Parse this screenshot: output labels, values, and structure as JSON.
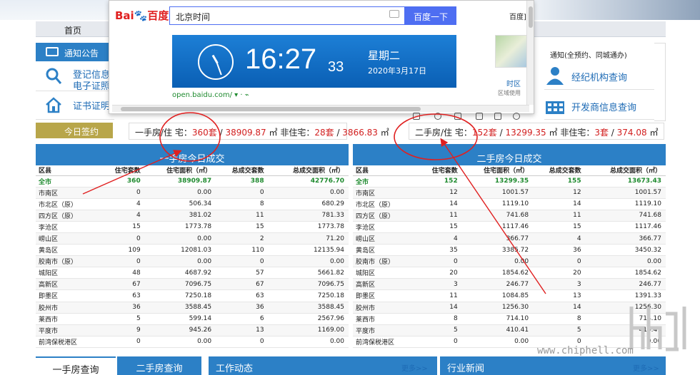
{
  "nav": {
    "home": "首页"
  },
  "notice": {
    "title": "通知公告"
  },
  "left_links": [
    {
      "line1": "登记信息",
      "line2": "电子证照"
    },
    {
      "line1": "证书证明",
      "line2": ""
    }
  ],
  "sign_label": "今日签约",
  "right_notice": "通知(全预约、同城通办)",
  "right_links": [
    {
      "label": "经纪机构查询"
    },
    {
      "label": "开发商信息查询"
    }
  ],
  "summary_new": {
    "prefix1": "一手房/住 宅：",
    "res_count": "360套",
    "sep1": " / ",
    "res_area": "38909.87",
    "unit1": " ㎡ 非住宅：",
    "non_count": "28套",
    "sep2": " / ",
    "non_area": "3866.83",
    "unit2": " ㎡"
  },
  "summary_used": {
    "prefix1": "二手房/住 宅：",
    "res_count": "152套",
    "sep1": " / ",
    "res_area": "13299.35",
    "unit1": " ㎡ 非住宅：",
    "non_count": "3套",
    "sep2": " / ",
    "non_area": "374.08",
    "unit2": " ㎡"
  },
  "table_new": {
    "title": "一手房今日成交",
    "headers": [
      "区县",
      "住宅套数",
      "住宅面积（㎡）",
      "总成交套数",
      "总成交面积（㎡）"
    ],
    "rows": [
      [
        "全市",
        "360",
        "38909.87",
        "388",
        "42776.70"
      ],
      [
        "市南区",
        "0",
        "0.00",
        "0",
        "0.00"
      ],
      [
        "市北区（原）",
        "4",
        "506.34",
        "8",
        "680.29"
      ],
      [
        "四方区（原）",
        "4",
        "381.02",
        "11",
        "781.33"
      ],
      [
        "李沧区",
        "15",
        "1773.78",
        "15",
        "1773.78"
      ],
      [
        "崂山区",
        "0",
        "0.00",
        "2",
        "71.20"
      ],
      [
        "黄岛区",
        "109",
        "12081.03",
        "110",
        "12135.94"
      ],
      [
        "胶南市（原）",
        "0",
        "0.00",
        "0",
        "0.00"
      ],
      [
        "城阳区",
        "48",
        "4687.92",
        "57",
        "5661.82"
      ],
      [
        "高新区",
        "67",
        "7096.75",
        "67",
        "7096.75"
      ],
      [
        "即墨区",
        "63",
        "7250.18",
        "63",
        "7250.18"
      ],
      [
        "胶州市",
        "36",
        "3588.45",
        "36",
        "3588.45"
      ],
      [
        "莱西市",
        "5",
        "599.14",
        "6",
        "2567.96"
      ],
      [
        "平度市",
        "9",
        "945.26",
        "13",
        "1169.00"
      ],
      [
        "前湾保税港区",
        "0",
        "0.00",
        "0",
        "0.00"
      ]
    ]
  },
  "table_used": {
    "title": "二手房今日成交",
    "headers": [
      "区县",
      "住宅套数",
      "住宅面积（㎡）",
      "总成交套数",
      "总成交面积（㎡）"
    ],
    "rows": [
      [
        "全市",
        "152",
        "13299.35",
        "155",
        "13673.43"
      ],
      [
        "市南区",
        "12",
        "1001.57",
        "12",
        "1001.57"
      ],
      [
        "市北区（原）",
        "14",
        "1119.10",
        "14",
        "1119.10"
      ],
      [
        "四方区（原）",
        "11",
        "741.68",
        "11",
        "741.68"
      ],
      [
        "李沧区",
        "15",
        "1117.46",
        "15",
        "1117.46"
      ],
      [
        "崂山区",
        "4",
        "366.77",
        "4",
        "366.77"
      ],
      [
        "黄岛区",
        "35",
        "3385.72",
        "36",
        "3450.32"
      ],
      [
        "胶南市（原）",
        "0",
        "0.00",
        "0",
        "0.00"
      ],
      [
        "城阳区",
        "20",
        "1854.62",
        "20",
        "1854.62"
      ],
      [
        "高新区",
        "3",
        "246.77",
        "3",
        "246.77"
      ],
      [
        "即墨区",
        "11",
        "1084.85",
        "13",
        "1391.33"
      ],
      [
        "胶州市",
        "14",
        "1256.30",
        "14",
        "1256.30"
      ],
      [
        "莱西市",
        "8",
        "714.10",
        "8",
        "714.10"
      ],
      [
        "平度市",
        "5",
        "410.41",
        "5",
        "410.41"
      ],
      [
        "前湾保税港区",
        "0",
        "0.00",
        "0",
        "0.00"
      ]
    ]
  },
  "bottom": {
    "tab1": "一手房查询",
    "tab2": "二手房查询",
    "work": "工作动态",
    "more1": "更多>>",
    "industry": "行业新闻",
    "more2": "更多>>"
  },
  "watermark": "www.chiphell.com",
  "baidu": {
    "query": "北京时间",
    "button": "百度一下",
    "corner": "百度]",
    "time": "16:27",
    "seconds": "33",
    "weekday": "星期二",
    "date": "2020年3月17日",
    "source": "open.baidu.com/ ▾ · ⌁",
    "map_label": "时区",
    "map_text": "区域使用"
  },
  "colors": {
    "accent": "#2c80c6",
    "highlight_red": "#d21f1f",
    "total_green": "#1e8a2e",
    "annotation": "#e02020"
  }
}
